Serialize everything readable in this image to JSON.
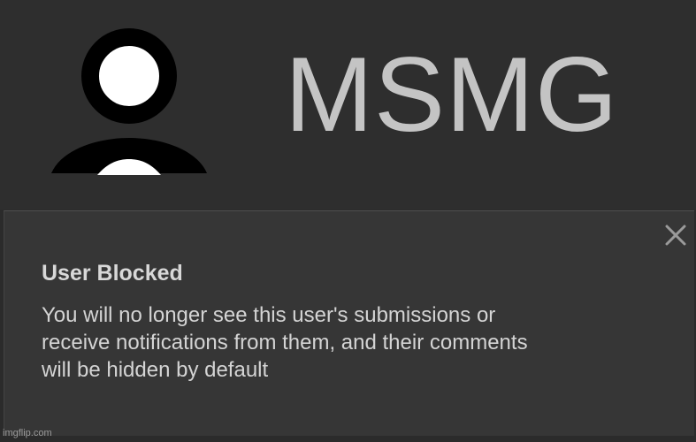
{
  "header": {
    "avatar_icon": "user-silhouette-icon",
    "username": "MSMG"
  },
  "toast": {
    "close_icon": "close-icon",
    "title": "User Blocked",
    "message_lines": [
      "You will no longer see this user's submissions or",
      "receive notifications from them, and their comments",
      "will be hidden by default"
    ]
  },
  "watermark": "imgflip.com",
  "colors": {
    "background": "#2e2e2e",
    "toast_background": "#363636",
    "username_text": "#c4c4c4",
    "toast_text": "#d4d4d4",
    "icon_close": "#9a9a9a"
  }
}
